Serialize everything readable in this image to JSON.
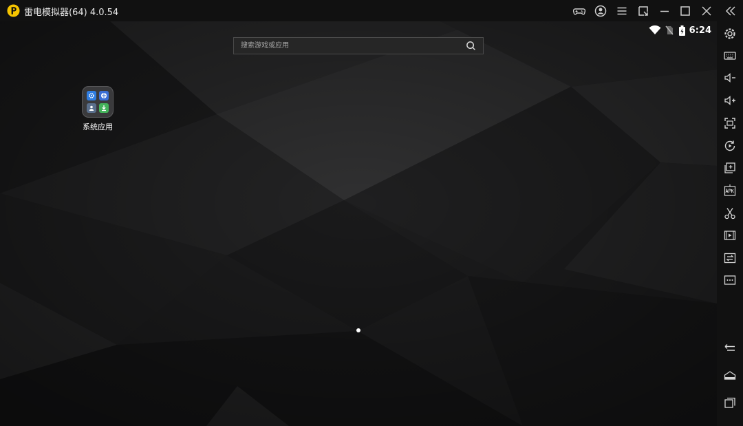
{
  "window": {
    "title": "雷电模拟器(64) 4.0.54"
  },
  "status_bar": {
    "time": "6:24"
  },
  "search": {
    "placeholder": "搜索游戏或应用"
  },
  "desktop": {
    "folder_label": "系统应用"
  },
  "colors": {
    "logo_yellow": "#f5c400",
    "titlebar_bg": "#111111",
    "sidebar_bg": "#111111",
    "icon_gray": "#cfcfcf"
  },
  "icons": {
    "titlebar": [
      "gamepad-icon",
      "account-icon",
      "menu-icon",
      "restore-window-icon",
      "minimize-icon",
      "maximize-icon",
      "close-icon",
      "collapse-sidebar-icon"
    ],
    "sidebar": [
      "settings-icon",
      "keyboard-icon",
      "volume-down-icon",
      "volume-up-icon",
      "screenshot-icon",
      "rotate-icon",
      "multi-instance-icon",
      "install-apk-icon",
      "cut-icon",
      "video-record-icon",
      "sync-icon",
      "more-icon",
      "back-icon",
      "home-icon",
      "recent-apps-icon"
    ]
  }
}
